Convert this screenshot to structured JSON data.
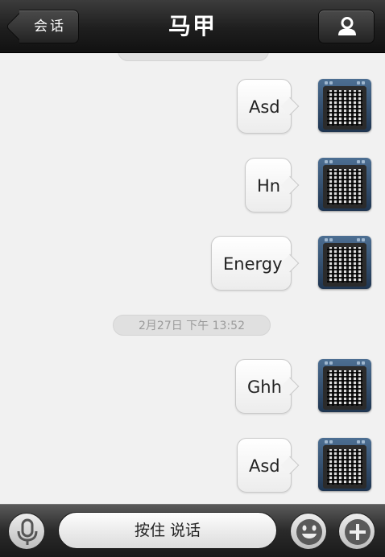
{
  "header": {
    "back_label": "会话",
    "title": "马甲",
    "profile_icon": "person-icon"
  },
  "chat": {
    "timestamp_top": "",
    "timestamp_mid": "2月27日 下午 13:52",
    "messages": [
      {
        "text": "Asd",
        "sender": "me"
      },
      {
        "text": "Hn",
        "sender": "me"
      },
      {
        "text": "Energy",
        "sender": "me"
      },
      {
        "text": "Ghh",
        "sender": "me"
      },
      {
        "text": "Asd",
        "sender": "me"
      }
    ]
  },
  "input_bar": {
    "voice_icon": "microphone-icon",
    "hold_to_talk": "按住 说话",
    "emoji_icon": "smiley-icon",
    "more_icon": "plus-icon"
  }
}
